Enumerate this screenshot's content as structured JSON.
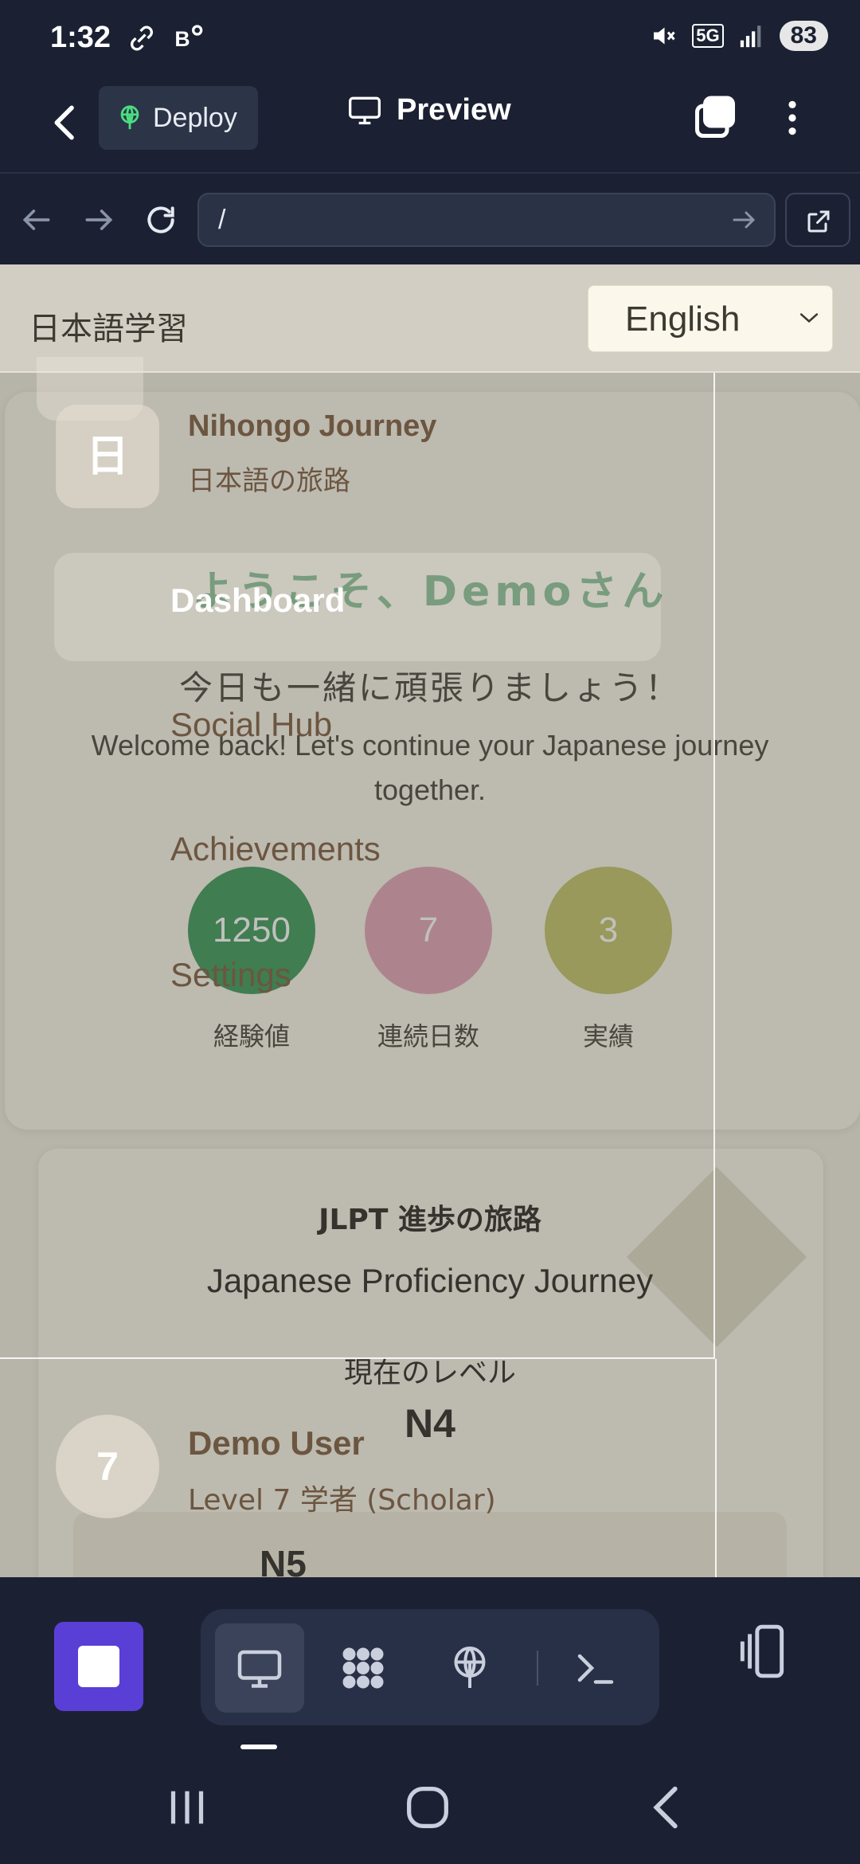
{
  "status_bar": {
    "time": "1:32",
    "network": "5G",
    "battery": "83"
  },
  "toolbar": {
    "deploy_label": "Deploy",
    "preview_label": "Preview"
  },
  "browser": {
    "url": "/"
  },
  "site": {
    "header_title": "日本語学習",
    "language_selected": "English"
  },
  "sidebar": {
    "logo_char": "日",
    "brand_name": "Nihongo Journey",
    "brand_sub": "日本語の旅路",
    "nav_items": [
      {
        "label": "Dashboard",
        "active": true
      },
      {
        "label": "Social Hub",
        "active": false
      },
      {
        "label": "Achievements",
        "active": false
      },
      {
        "label": "Settings",
        "active": false
      }
    ],
    "user": {
      "avatar": "7",
      "name": "Demo User",
      "level": "Level 7 学者 (Scholar)"
    }
  },
  "welcome": {
    "title": "ようこそ、Demoさん",
    "subtitle_jp": "今日も一緒に頑張りましょう！",
    "subtitle_en": "Welcome back! Let's continue your Japanese journey together.",
    "stats": [
      {
        "value": "1250",
        "label": "経験値",
        "color": "#3d9a5c"
      },
      {
        "value": "7",
        "label": "連続日数",
        "color": "#e2a5b6"
      },
      {
        "value": "3",
        "label": "実績",
        "color": "#c3c46a"
      }
    ]
  },
  "jlpt": {
    "title": "JLPT 進歩の旅路",
    "subtitle": "Japanese Proficiency Journey",
    "current_level_label": "現在のレベル",
    "current_level": "N4",
    "first_level": "N5"
  },
  "colors": {
    "app_bg": "#1b2133",
    "accent": "#5a3fd6",
    "deploy_icon": "#4ade80"
  }
}
